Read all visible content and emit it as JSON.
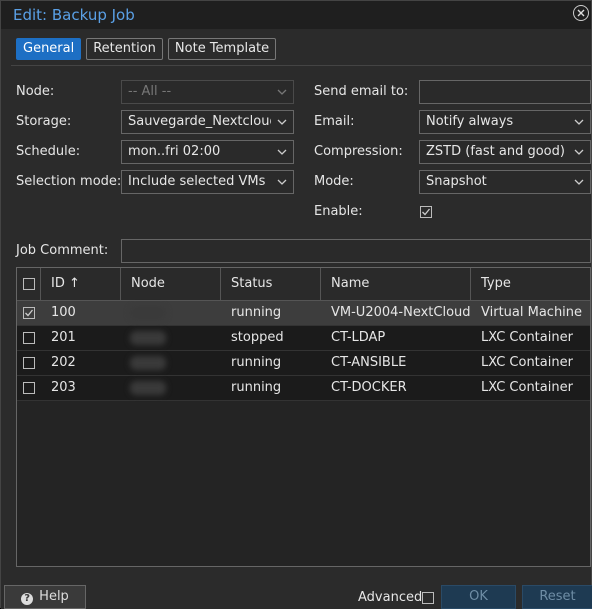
{
  "window": {
    "title": "Edit: Backup Job"
  },
  "tabs": [
    {
      "label": "General",
      "active": true
    },
    {
      "label": "Retention",
      "active": false
    },
    {
      "label": "Note Template",
      "active": false
    }
  ],
  "form": {
    "node": {
      "label": "Node:",
      "value": "-- All --"
    },
    "storage": {
      "label": "Storage:",
      "value": "Sauvegarde_Nextcloud_"
    },
    "schedule": {
      "label": "Schedule:",
      "value": "mon..fri 02:00"
    },
    "selection_mode": {
      "label": "Selection mode:",
      "value": "Include selected VMs"
    },
    "send_email": {
      "label": "Send email to:",
      "value": ""
    },
    "email": {
      "label": "Email:",
      "value": "Notify always"
    },
    "compression": {
      "label": "Compression:",
      "value": "ZSTD (fast and good)"
    },
    "mode": {
      "label": "Mode:",
      "value": "Snapshot"
    },
    "enable": {
      "label": "Enable:",
      "checked": true
    },
    "job_comment": {
      "label": "Job Comment:",
      "value": ""
    }
  },
  "grid": {
    "columns": [
      "ID ↑",
      "Node",
      "Status",
      "Name",
      "Type"
    ],
    "rows": [
      {
        "checked": true,
        "id": "100",
        "status": "running",
        "name": "VM-U2004-NextCloud",
        "type": "Virtual Machine"
      },
      {
        "checked": false,
        "id": "201",
        "status": "stopped",
        "name": "CT-LDAP",
        "type": "LXC Container"
      },
      {
        "checked": false,
        "id": "202",
        "status": "running",
        "name": "CT-ANSIBLE",
        "type": "LXC Container"
      },
      {
        "checked": false,
        "id": "203",
        "status": "running",
        "name": "CT-DOCKER",
        "type": "LXC Container"
      }
    ]
  },
  "footer": {
    "help_label": "Help",
    "advanced_label": "Advanced",
    "ok_label": "OK",
    "reset_label": "Reset"
  },
  "colors": {
    "accent": "#1d6fc4",
    "title": "#5aa0e6",
    "background": "#2b2b2b"
  },
  "icons": [
    "close-icon",
    "chevron-down-icon",
    "checkmark-icon",
    "help-icon",
    "sort-ascending-icon"
  ]
}
